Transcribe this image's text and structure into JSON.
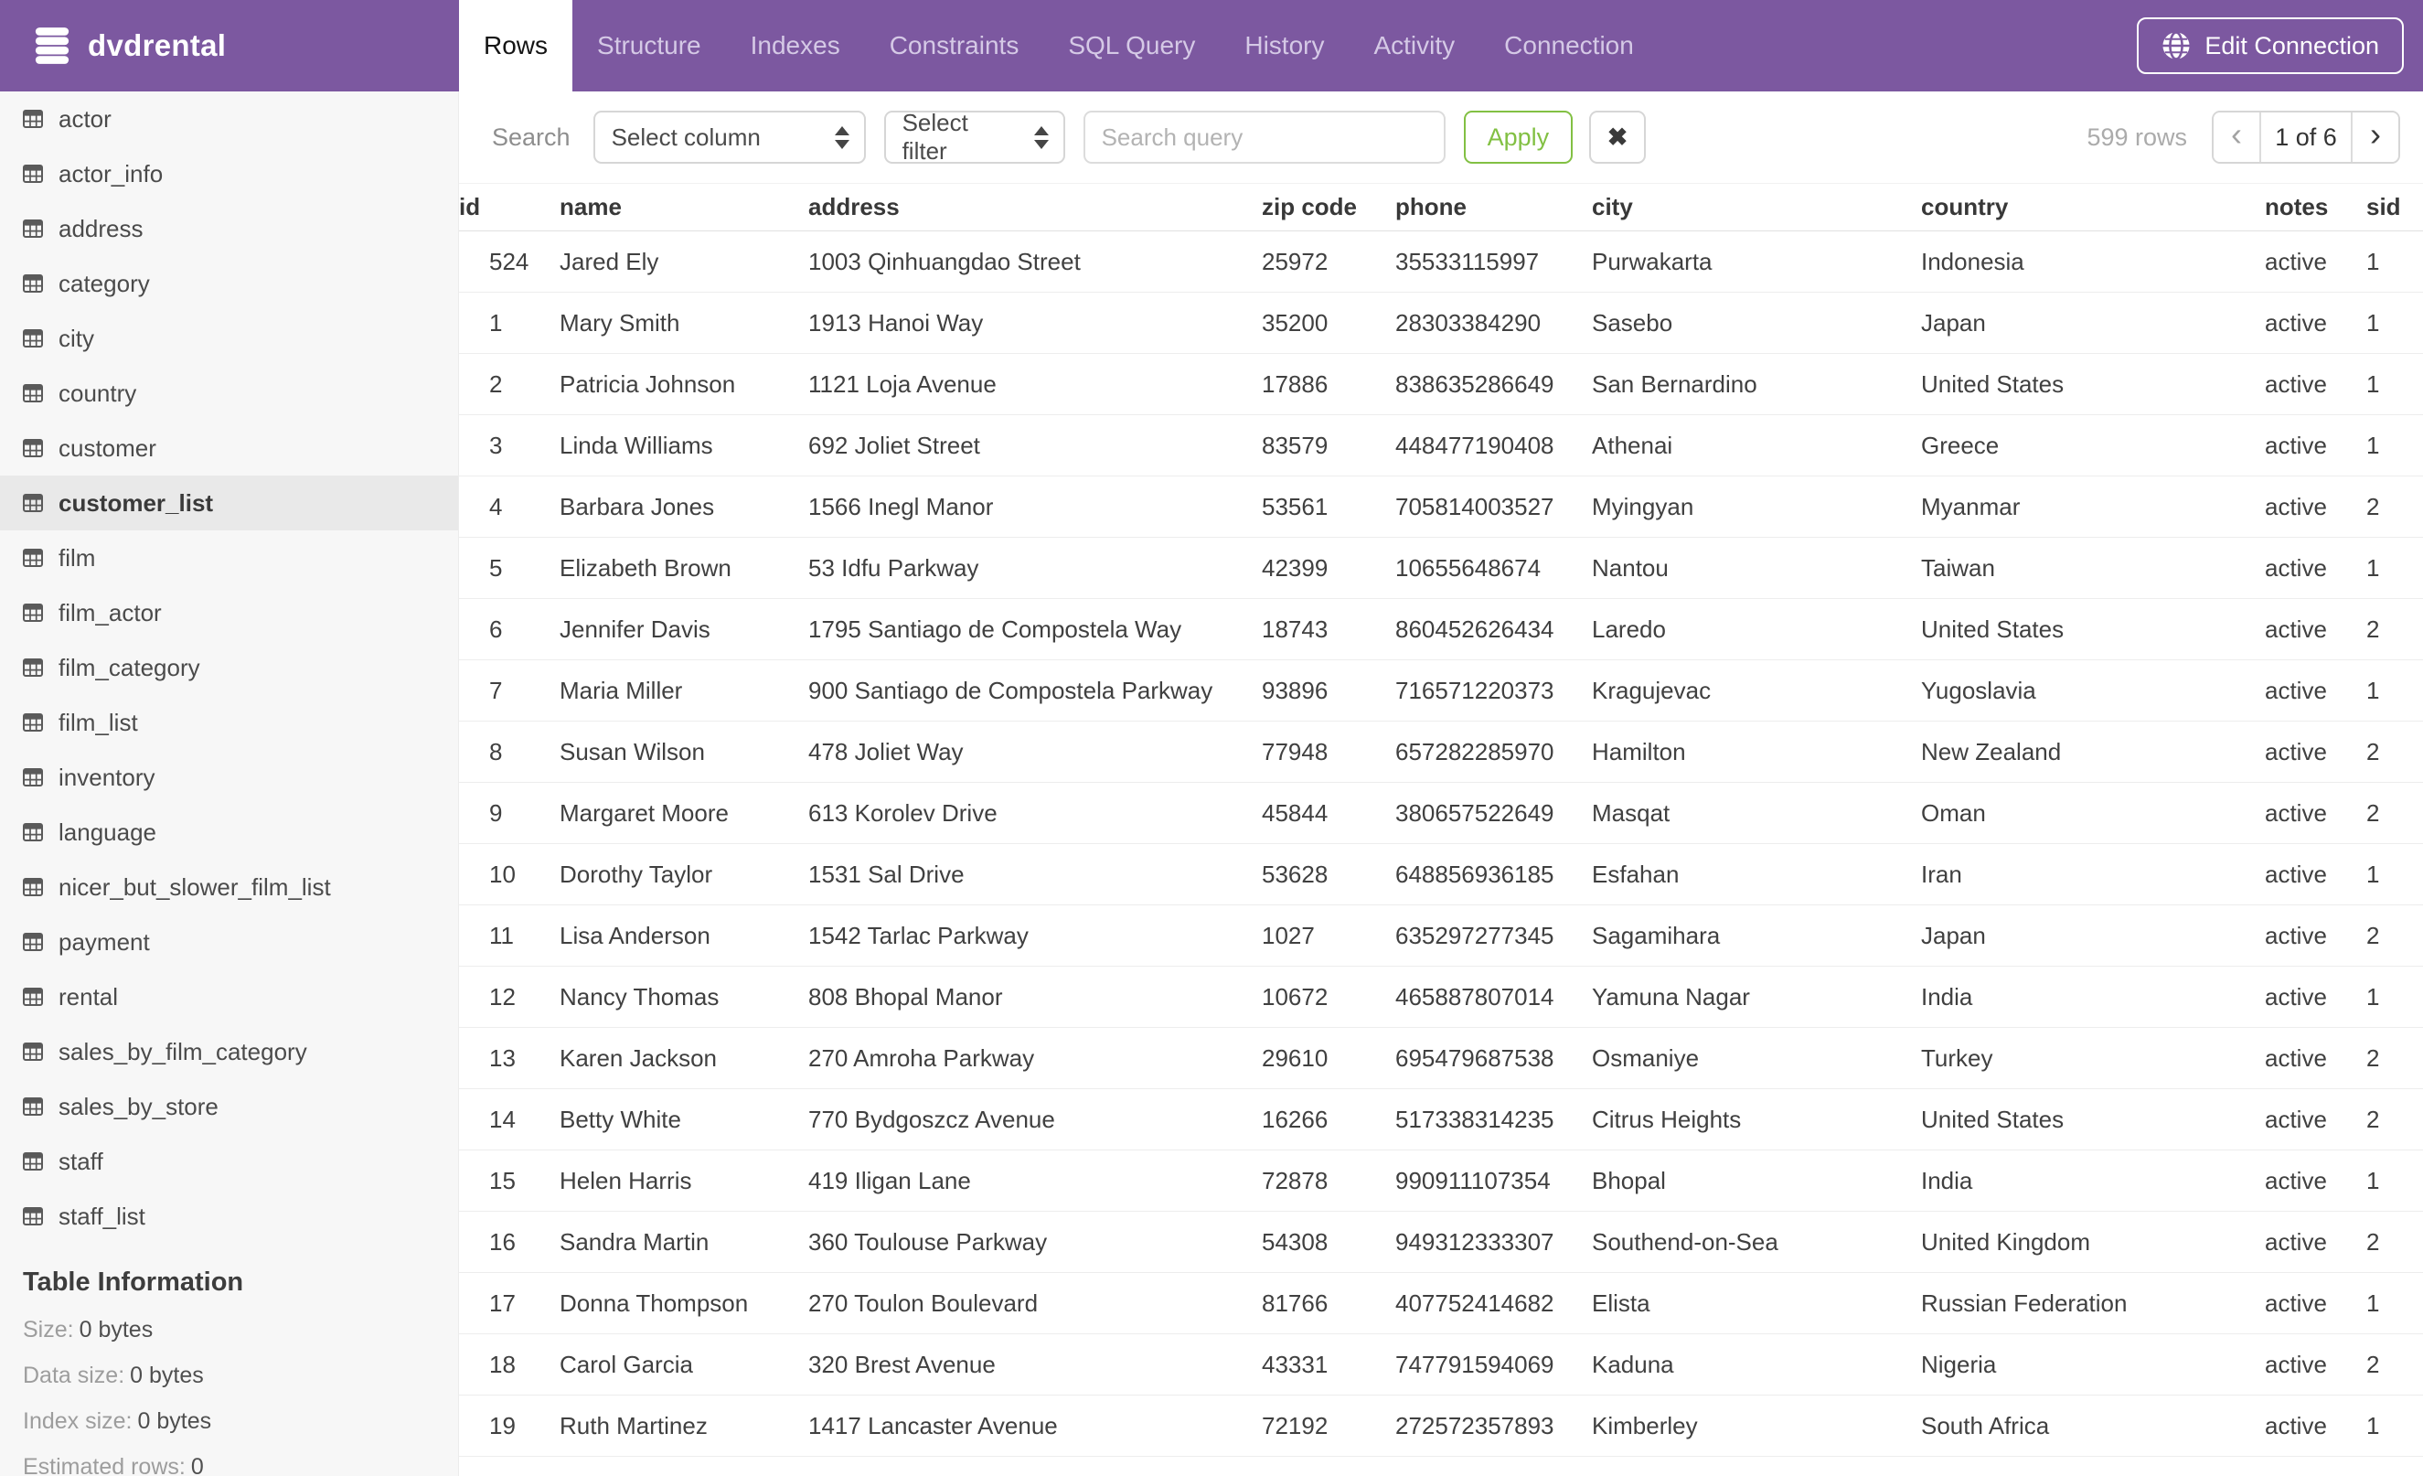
{
  "header": {
    "brand": "dvdrental",
    "tabs": [
      {
        "label": "Rows",
        "active": true
      },
      {
        "label": "Structure",
        "active": false
      },
      {
        "label": "Indexes",
        "active": false
      },
      {
        "label": "Constraints",
        "active": false
      },
      {
        "label": "SQL Query",
        "active": false
      },
      {
        "label": "History",
        "active": false
      },
      {
        "label": "Activity",
        "active": false
      },
      {
        "label": "Connection",
        "active": false
      }
    ],
    "edit_connection_label": "Edit Connection"
  },
  "sidebar": {
    "tables": [
      {
        "name": "actor",
        "selected": false
      },
      {
        "name": "actor_info",
        "selected": false
      },
      {
        "name": "address",
        "selected": false
      },
      {
        "name": "category",
        "selected": false
      },
      {
        "name": "city",
        "selected": false
      },
      {
        "name": "country",
        "selected": false
      },
      {
        "name": "customer",
        "selected": false
      },
      {
        "name": "customer_list",
        "selected": true
      },
      {
        "name": "film",
        "selected": false
      },
      {
        "name": "film_actor",
        "selected": false
      },
      {
        "name": "film_category",
        "selected": false
      },
      {
        "name": "film_list",
        "selected": false
      },
      {
        "name": "inventory",
        "selected": false
      },
      {
        "name": "language",
        "selected": false
      },
      {
        "name": "nicer_but_slower_film_list",
        "selected": false
      },
      {
        "name": "payment",
        "selected": false
      },
      {
        "name": "rental",
        "selected": false
      },
      {
        "name": "sales_by_film_category",
        "selected": false
      },
      {
        "name": "sales_by_store",
        "selected": false
      },
      {
        "name": "staff",
        "selected": false
      },
      {
        "name": "staff_list",
        "selected": false
      }
    ],
    "table_information": {
      "title": "Table Information",
      "rows": [
        {
          "label": "Size:",
          "value": "0 bytes"
        },
        {
          "label": "Data size:",
          "value": "0 bytes"
        },
        {
          "label": "Index size:",
          "value": "0 bytes"
        },
        {
          "label": "Estimated rows:",
          "value": "0"
        }
      ]
    }
  },
  "toolbar": {
    "search_label": "Search",
    "column_select_value": "Select column",
    "filter_select_value": "Select filter",
    "query_placeholder": "Search query",
    "query_value": "",
    "apply_label": "Apply",
    "clear_label": "✖",
    "row_count": "599 rows",
    "pagination": {
      "prev": "‹",
      "current": "1 of 6",
      "next": "›"
    }
  },
  "table": {
    "columns": [
      "id",
      "name",
      "address",
      "zip code",
      "phone",
      "city",
      "country",
      "notes",
      "sid"
    ],
    "rows": [
      [
        "524",
        "Jared Ely",
        "1003 Qinhuangdao Street",
        "25972",
        "35533115997",
        "Purwakarta",
        "Indonesia",
        "active",
        "1"
      ],
      [
        "1",
        "Mary Smith",
        "1913 Hanoi Way",
        "35200",
        "28303384290",
        "Sasebo",
        "Japan",
        "active",
        "1"
      ],
      [
        "2",
        "Patricia Johnson",
        "1121 Loja Avenue",
        "17886",
        "838635286649",
        "San Bernardino",
        "United States",
        "active",
        "1"
      ],
      [
        "3",
        "Linda Williams",
        "692 Joliet Street",
        "83579",
        "448477190408",
        "Athenai",
        "Greece",
        "active",
        "1"
      ],
      [
        "4",
        "Barbara Jones",
        "1566 Inegl Manor",
        "53561",
        "705814003527",
        "Myingyan",
        "Myanmar",
        "active",
        "2"
      ],
      [
        "5",
        "Elizabeth Brown",
        "53 Idfu Parkway",
        "42399",
        "10655648674",
        "Nantou",
        "Taiwan",
        "active",
        "1"
      ],
      [
        "6",
        "Jennifer Davis",
        "1795 Santiago de Compostela Way",
        "18743",
        "860452626434",
        "Laredo",
        "United States",
        "active",
        "2"
      ],
      [
        "7",
        "Maria Miller",
        "900 Santiago de Compostela Parkway",
        "93896",
        "716571220373",
        "Kragujevac",
        "Yugoslavia",
        "active",
        "1"
      ],
      [
        "8",
        "Susan Wilson",
        "478 Joliet Way",
        "77948",
        "657282285970",
        "Hamilton",
        "New Zealand",
        "active",
        "2"
      ],
      [
        "9",
        "Margaret Moore",
        "613 Korolev Drive",
        "45844",
        "380657522649",
        "Masqat",
        "Oman",
        "active",
        "2"
      ],
      [
        "10",
        "Dorothy Taylor",
        "1531 Sal Drive",
        "53628",
        "648856936185",
        "Esfahan",
        "Iran",
        "active",
        "1"
      ],
      [
        "11",
        "Lisa Anderson",
        "1542 Tarlac Parkway",
        "1027",
        "635297277345",
        "Sagamihara",
        "Japan",
        "active",
        "2"
      ],
      [
        "12",
        "Nancy Thomas",
        "808 Bhopal Manor",
        "10672",
        "465887807014",
        "Yamuna Nagar",
        "India",
        "active",
        "1"
      ],
      [
        "13",
        "Karen Jackson",
        "270 Amroha Parkway",
        "29610",
        "695479687538",
        "Osmaniye",
        "Turkey",
        "active",
        "2"
      ],
      [
        "14",
        "Betty White",
        "770 Bydgoszcz Avenue",
        "16266",
        "517338314235",
        "Citrus Heights",
        "United States",
        "active",
        "2"
      ],
      [
        "15",
        "Helen Harris",
        "419 Iligan Lane",
        "72878",
        "990911107354",
        "Bhopal",
        "India",
        "active",
        "1"
      ],
      [
        "16",
        "Sandra Martin",
        "360 Toulouse Parkway",
        "54308",
        "949312333307",
        "Southend-on-Sea",
        "United Kingdom",
        "active",
        "2"
      ],
      [
        "17",
        "Donna Thompson",
        "270 Toulon Boulevard",
        "81766",
        "407752414682",
        "Elista",
        "Russian Federation",
        "active",
        "1"
      ],
      [
        "18",
        "Carol Garcia",
        "320 Brest Avenue",
        "43331",
        "747791594069",
        "Kaduna",
        "Nigeria",
        "active",
        "2"
      ],
      [
        "19",
        "Ruth Martinez",
        "1417 Lancaster Avenue",
        "72192",
        "272572357893",
        "Kimberley",
        "South Africa",
        "active",
        "1"
      ]
    ]
  },
  "colors": {
    "accent_purple": "#7c58a0",
    "inactive_tab_text": "#d5c9e6",
    "apply_green": "#82c043",
    "sidebar_bg": "#f7f7f7",
    "selected_item_bg": "#e9e9e9"
  }
}
